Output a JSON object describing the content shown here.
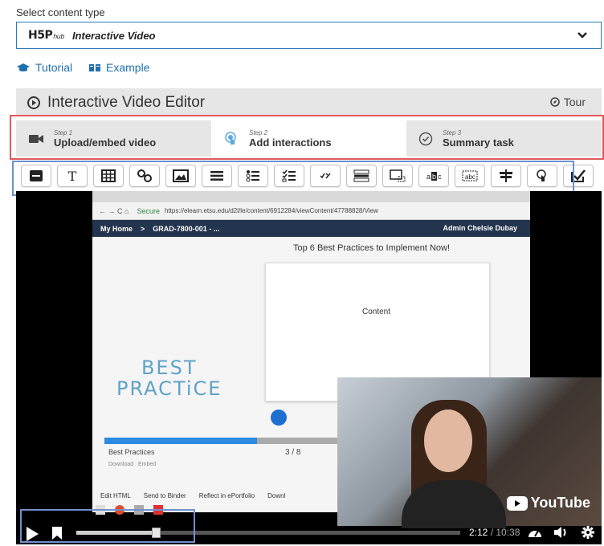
{
  "content_type": {
    "label": "Select content type",
    "logo": "H5P",
    "logo_sub": "hub",
    "selected": "Interactive Video"
  },
  "links": {
    "tutorial": "Tutorial",
    "example": "Example"
  },
  "editor": {
    "title": "Interactive Video Editor",
    "tour": "Tour"
  },
  "steps": [
    {
      "num": "Step 1",
      "label": "Upload/embed video",
      "icon": "video-camera-icon"
    },
    {
      "num": "Step 2",
      "label": "Add interactions",
      "icon": "touch-icon"
    },
    {
      "num": "Step 3",
      "label": "Summary task",
      "icon": "check-circle-icon"
    }
  ],
  "toolbar": {
    "tools": [
      "label",
      "text",
      "table",
      "link",
      "image",
      "statements",
      "single-choice-set",
      "multiple-choice",
      "true-false",
      "fill-in-blanks",
      "drag-and-drop",
      "mark-the-words",
      "drag-text",
      "crossroads",
      "navigation-hotspot",
      "free-text-question"
    ]
  },
  "video_frame": {
    "secure": "Secure",
    "url": "https://elearn.etsu.edu/d2l/le/content/6912284/viewContent/47788828/View",
    "lms_home": "My Home",
    "lms_course": "GRAD-7800-001 - ...",
    "lms_admin": "Admin Chelsie Dubay",
    "slide_title": "Top 6 Best Practices to Implement Now!",
    "content_label": "Content",
    "best_line1": "BEST",
    "best_line2": "PRACTiCE",
    "nav_label": "Best Practices",
    "pager": "3 / 8",
    "download": "Download",
    "embed": "Embed",
    "bottom_buttons": [
      "Edit HTML",
      "Send to Binder",
      "Reflect in ePortfolio",
      "Downl"
    ]
  },
  "player": {
    "youtube": "YouTube",
    "current_time": "2:12",
    "duration": "10:38",
    "progress": 0.207
  },
  "colors": {
    "accent": "#1f6fb0",
    "select_border": "#2b7bb9",
    "highlight_red": "#e05a5a",
    "highlight_blue": "#6f8fcf"
  }
}
